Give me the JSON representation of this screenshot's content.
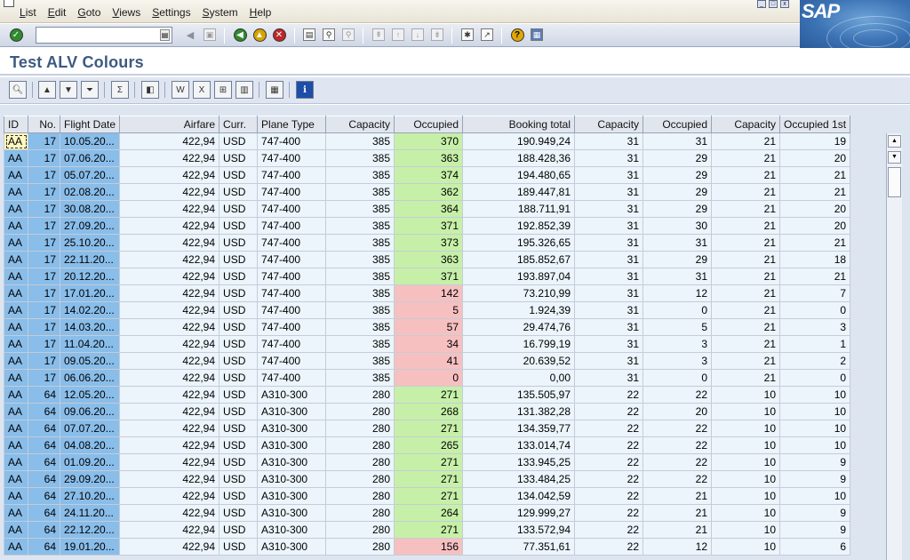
{
  "menu": {
    "items": [
      "List",
      "Edit",
      "Goto",
      "Views",
      "Settings",
      "System",
      "Help"
    ]
  },
  "logo": {
    "text": "SAP"
  },
  "command_field": {
    "value": ""
  },
  "title": "Test ALV Colours",
  "grid": {
    "headers": [
      "ID",
      "No.",
      "Flight Date",
      "Airfare",
      "Curr.",
      "Plane Type",
      "Capacity",
      "Occupied",
      "Booking total",
      "Capacity",
      "Occupied",
      "Capacity",
      "Occupied 1st"
    ],
    "rows": [
      {
        "id": "AA",
        "no": "17",
        "date": "10.05.20...",
        "fare": "422,94",
        "curr": "USD",
        "plane": "747-400",
        "cap": "385",
        "occ": "370",
        "occ_status": "green",
        "total": "190.949,24",
        "cap_b": "31",
        "occ_b": "31",
        "cap_f": "21",
        "occ_f": "19"
      },
      {
        "id": "AA",
        "no": "17",
        "date": "07.06.20...",
        "fare": "422,94",
        "curr": "USD",
        "plane": "747-400",
        "cap": "385",
        "occ": "363",
        "occ_status": "green",
        "total": "188.428,36",
        "cap_b": "31",
        "occ_b": "29",
        "cap_f": "21",
        "occ_f": "20"
      },
      {
        "id": "AA",
        "no": "17",
        "date": "05.07.20...",
        "fare": "422,94",
        "curr": "USD",
        "plane": "747-400",
        "cap": "385",
        "occ": "374",
        "occ_status": "green",
        "total": "194.480,65",
        "cap_b": "31",
        "occ_b": "29",
        "cap_f": "21",
        "occ_f": "21"
      },
      {
        "id": "AA",
        "no": "17",
        "date": "02.08.20...",
        "fare": "422,94",
        "curr": "USD",
        "plane": "747-400",
        "cap": "385",
        "occ": "362",
        "occ_status": "green",
        "total": "189.447,81",
        "cap_b": "31",
        "occ_b": "29",
        "cap_f": "21",
        "occ_f": "21"
      },
      {
        "id": "AA",
        "no": "17",
        "date": "30.08.20...",
        "fare": "422,94",
        "curr": "USD",
        "plane": "747-400",
        "cap": "385",
        "occ": "364",
        "occ_status": "green",
        "total": "188.711,91",
        "cap_b": "31",
        "occ_b": "29",
        "cap_f": "21",
        "occ_f": "20"
      },
      {
        "id": "AA",
        "no": "17",
        "date": "27.09.20...",
        "fare": "422,94",
        "curr": "USD",
        "plane": "747-400",
        "cap": "385",
        "occ": "371",
        "occ_status": "green",
        "total": "192.852,39",
        "cap_b": "31",
        "occ_b": "30",
        "cap_f": "21",
        "occ_f": "20"
      },
      {
        "id": "AA",
        "no": "17",
        "date": "25.10.20...",
        "fare": "422,94",
        "curr": "USD",
        "plane": "747-400",
        "cap": "385",
        "occ": "373",
        "occ_status": "green",
        "total": "195.326,65",
        "cap_b": "31",
        "occ_b": "31",
        "cap_f": "21",
        "occ_f": "21"
      },
      {
        "id": "AA",
        "no": "17",
        "date": "22.11.20...",
        "fare": "422,94",
        "curr": "USD",
        "plane": "747-400",
        "cap": "385",
        "occ": "363",
        "occ_status": "green",
        "total": "185.852,67",
        "cap_b": "31",
        "occ_b": "29",
        "cap_f": "21",
        "occ_f": "18"
      },
      {
        "id": "AA",
        "no": "17",
        "date": "20.12.20...",
        "fare": "422,94",
        "curr": "USD",
        "plane": "747-400",
        "cap": "385",
        "occ": "371",
        "occ_status": "green",
        "total": "193.897,04",
        "cap_b": "31",
        "occ_b": "31",
        "cap_f": "21",
        "occ_f": "21"
      },
      {
        "id": "AA",
        "no": "17",
        "date": "17.01.20...",
        "fare": "422,94",
        "curr": "USD",
        "plane": "747-400",
        "cap": "385",
        "occ": "142",
        "occ_status": "red",
        "total": "73.210,99",
        "cap_b": "31",
        "occ_b": "12",
        "cap_f": "21",
        "occ_f": "7"
      },
      {
        "id": "AA",
        "no": "17",
        "date": "14.02.20...",
        "fare": "422,94",
        "curr": "USD",
        "plane": "747-400",
        "cap": "385",
        "occ": "5",
        "occ_status": "red",
        "total": "1.924,39",
        "cap_b": "31",
        "occ_b": "0",
        "cap_f": "21",
        "occ_f": "0"
      },
      {
        "id": "AA",
        "no": "17",
        "date": "14.03.20...",
        "fare": "422,94",
        "curr": "USD",
        "plane": "747-400",
        "cap": "385",
        "occ": "57",
        "occ_status": "red",
        "total": "29.474,76",
        "cap_b": "31",
        "occ_b": "5",
        "cap_f": "21",
        "occ_f": "3"
      },
      {
        "id": "AA",
        "no": "17",
        "date": "11.04.20...",
        "fare": "422,94",
        "curr": "USD",
        "plane": "747-400",
        "cap": "385",
        "occ": "34",
        "occ_status": "red",
        "total": "16.799,19",
        "cap_b": "31",
        "occ_b": "3",
        "cap_f": "21",
        "occ_f": "1"
      },
      {
        "id": "AA",
        "no": "17",
        "date": "09.05.20...",
        "fare": "422,94",
        "curr": "USD",
        "plane": "747-400",
        "cap": "385",
        "occ": "41",
        "occ_status": "red",
        "total": "20.639,52",
        "cap_b": "31",
        "occ_b": "3",
        "cap_f": "21",
        "occ_f": "2"
      },
      {
        "id": "AA",
        "no": "17",
        "date": "06.06.20...",
        "fare": "422,94",
        "curr": "USD",
        "plane": "747-400",
        "cap": "385",
        "occ": "0",
        "occ_status": "red",
        "total": "0,00",
        "cap_b": "31",
        "occ_b": "0",
        "cap_f": "21",
        "occ_f": "0"
      },
      {
        "id": "AA",
        "no": "64",
        "date": "12.05.20...",
        "fare": "422,94",
        "curr": "USD",
        "plane": "A310-300",
        "cap": "280",
        "occ": "271",
        "occ_status": "green",
        "total": "135.505,97",
        "cap_b": "22",
        "occ_b": "22",
        "cap_f": "10",
        "occ_f": "10"
      },
      {
        "id": "AA",
        "no": "64",
        "date": "09.06.20...",
        "fare": "422,94",
        "curr": "USD",
        "plane": "A310-300",
        "cap": "280",
        "occ": "268",
        "occ_status": "green",
        "total": "131.382,28",
        "cap_b": "22",
        "occ_b": "20",
        "cap_f": "10",
        "occ_f": "10"
      },
      {
        "id": "AA",
        "no": "64",
        "date": "07.07.20...",
        "fare": "422,94",
        "curr": "USD",
        "plane": "A310-300",
        "cap": "280",
        "occ": "271",
        "occ_status": "green",
        "total": "134.359,77",
        "cap_b": "22",
        "occ_b": "22",
        "cap_f": "10",
        "occ_f": "10"
      },
      {
        "id": "AA",
        "no": "64",
        "date": "04.08.20...",
        "fare": "422,94",
        "curr": "USD",
        "plane": "A310-300",
        "cap": "280",
        "occ": "265",
        "occ_status": "green",
        "total": "133.014,74",
        "cap_b": "22",
        "occ_b": "22",
        "cap_f": "10",
        "occ_f": "10"
      },
      {
        "id": "AA",
        "no": "64",
        "date": "01.09.20...",
        "fare": "422,94",
        "curr": "USD",
        "plane": "A310-300",
        "cap": "280",
        "occ": "271",
        "occ_status": "green",
        "total": "133.945,25",
        "cap_b": "22",
        "occ_b": "22",
        "cap_f": "10",
        "occ_f": "9"
      },
      {
        "id": "AA",
        "no": "64",
        "date": "29.09.20...",
        "fare": "422,94",
        "curr": "USD",
        "plane": "A310-300",
        "cap": "280",
        "occ": "271",
        "occ_status": "green",
        "total": "133.484,25",
        "cap_b": "22",
        "occ_b": "22",
        "cap_f": "10",
        "occ_f": "9"
      },
      {
        "id": "AA",
        "no": "64",
        "date": "27.10.20...",
        "fare": "422,94",
        "curr": "USD",
        "plane": "A310-300",
        "cap": "280",
        "occ": "271",
        "occ_status": "green",
        "total": "134.042,59",
        "cap_b": "22",
        "occ_b": "21",
        "cap_f": "10",
        "occ_f": "10"
      },
      {
        "id": "AA",
        "no": "64",
        "date": "24.11.20...",
        "fare": "422,94",
        "curr": "USD",
        "plane": "A310-300",
        "cap": "280",
        "occ": "264",
        "occ_status": "green",
        "total": "129.999,27",
        "cap_b": "22",
        "occ_b": "21",
        "cap_f": "10",
        "occ_f": "9"
      },
      {
        "id": "AA",
        "no": "64",
        "date": "22.12.20...",
        "fare": "422,94",
        "curr": "USD",
        "plane": "A310-300",
        "cap": "280",
        "occ": "271",
        "occ_status": "green",
        "total": "133.572,94",
        "cap_b": "22",
        "occ_b": "21",
        "cap_f": "10",
        "occ_f": "9"
      },
      {
        "id": "AA",
        "no": "64",
        "date": "19.01.20...",
        "fare": "422,94",
        "curr": "USD",
        "plane": "A310-300",
        "cap": "280",
        "occ": "156",
        "occ_status": "red",
        "total": "77.351,61",
        "cap_b": "22",
        "occ_b": "12",
        "cap_f": "10",
        "occ_f": "6"
      }
    ]
  },
  "colors": {
    "key_column": "#89bdea",
    "occupied_ok": "#c6f0a8",
    "occupied_low": "#f6c0c1",
    "cell_default": "#ebf5fb",
    "title": "#3d5a80"
  }
}
